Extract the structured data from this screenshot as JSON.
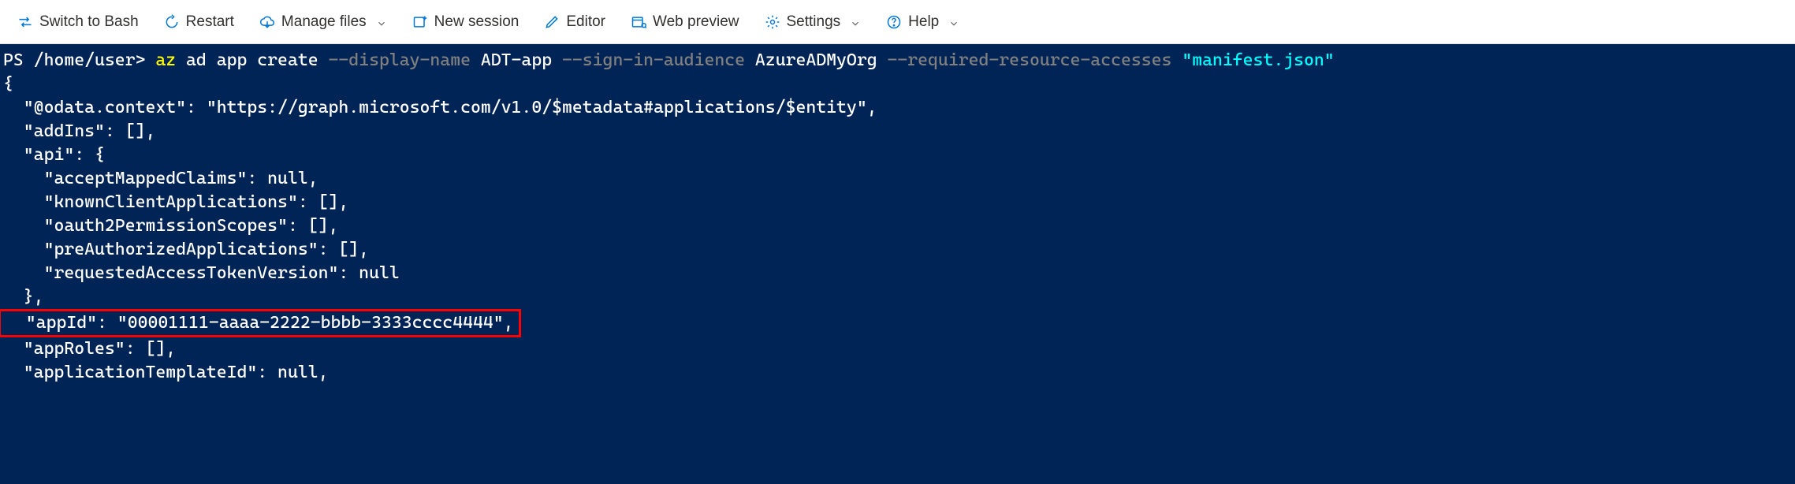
{
  "toolbar": {
    "switch_label": "Switch to Bash",
    "restart_label": "Restart",
    "manage_files_label": "Manage files",
    "new_session_label": "New session",
    "editor_label": "Editor",
    "web_preview_label": "Web preview",
    "settings_label": "Settings",
    "help_label": "Help"
  },
  "terminal": {
    "prompt_prefix": "PS ",
    "prompt_path": "/home/user>",
    "cmd_az": "az",
    "cmd_sub": " ad app create ",
    "flag_display": "--display-name",
    "arg_display": " ADT-app ",
    "flag_audience": "--sign-in-audience",
    "arg_audience": " AzureADMyOrg ",
    "flag_resources": "--required-resource-accesses",
    "arg_manifest": " \"manifest.json\"",
    "output": {
      "line_open": "{",
      "line_odata": "  \"@odata.context\": \"https://graph.microsoft.com/v1.0/$metadata#applications/$entity\",",
      "line_addins": "  \"addIns\": [],",
      "line_api_open": "  \"api\": {",
      "line_amc": "    \"acceptMappedClaims\": null,",
      "line_kca": "    \"knownClientApplications\": [],",
      "line_ops": "    \"oauth2PermissionScopes\": [],",
      "line_paa": "    \"preAuthorizedApplications\": [],",
      "line_ratv": "    \"requestedAccessTokenVersion\": null",
      "line_api_close": "  },",
      "line_appid": "  \"appId\": \"00001111-aaaa-2222-bbbb-3333cccc4444\",",
      "line_approles": "  \"appRoles\": [],",
      "line_atid": "  \"applicationTemplateId\": null,"
    }
  }
}
